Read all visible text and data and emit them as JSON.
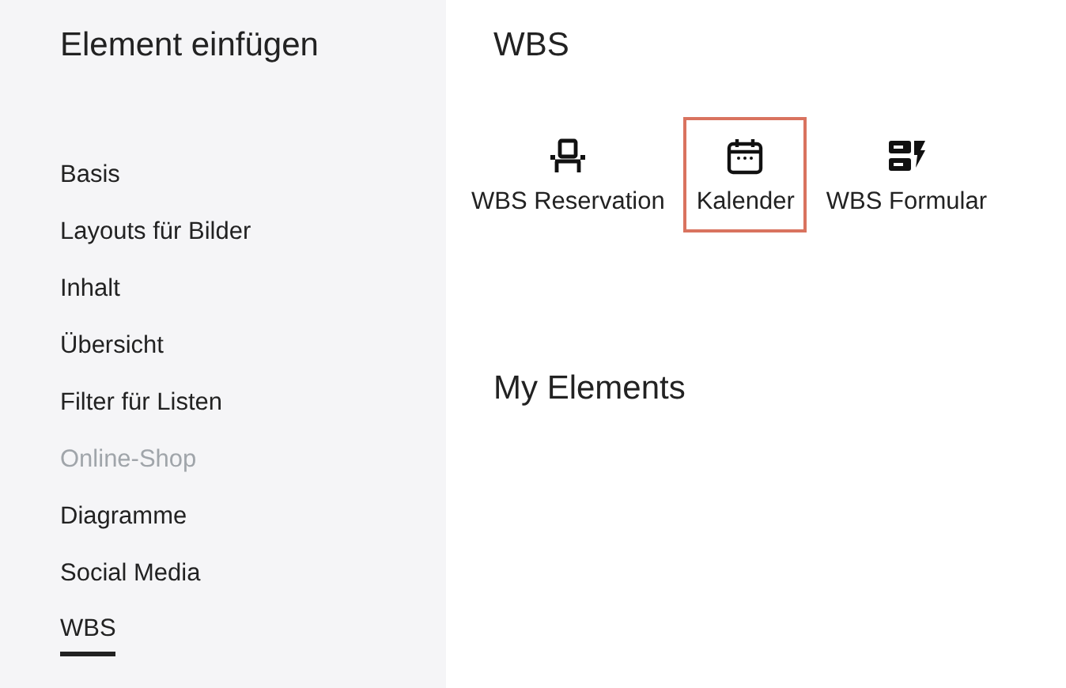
{
  "sidebar": {
    "title": "Element einfügen",
    "items": [
      {
        "label": "Basis",
        "selected": false,
        "disabled": false
      },
      {
        "label": "Layouts für Bilder",
        "selected": false,
        "disabled": false
      },
      {
        "label": "Inhalt",
        "selected": false,
        "disabled": false
      },
      {
        "label": "Übersicht",
        "selected": false,
        "disabled": false
      },
      {
        "label": "Filter für Listen",
        "selected": false,
        "disabled": false
      },
      {
        "label": "Online-Shop",
        "selected": false,
        "disabled": true
      },
      {
        "label": "Diagramme",
        "selected": false,
        "disabled": false
      },
      {
        "label": "Social Media",
        "selected": false,
        "disabled": false
      },
      {
        "label": "WBS",
        "selected": true,
        "disabled": false
      }
    ]
  },
  "sections": [
    {
      "title": "WBS",
      "elements": [
        {
          "label": "WBS Reservation",
          "kind": "chair",
          "selected": false
        },
        {
          "label": "Kalender",
          "kind": "calendar",
          "selected": true
        },
        {
          "label": "WBS Formular",
          "kind": "form",
          "selected": false
        }
      ]
    },
    {
      "title": "My Elements"
    }
  ]
}
